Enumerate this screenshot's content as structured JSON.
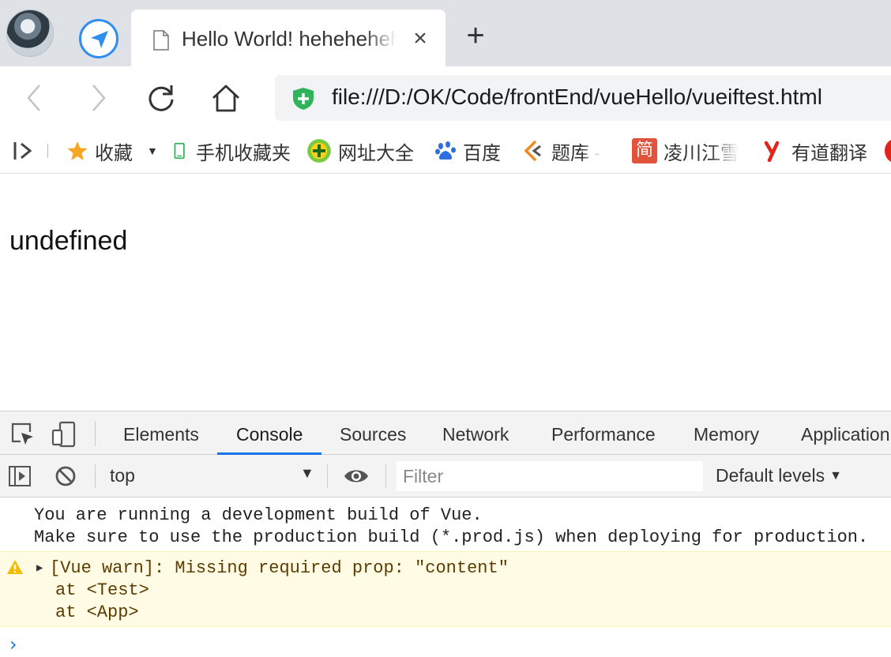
{
  "tabstrip": {
    "tab_title": "Hello World! hehehehehe",
    "new_tab_label": "+",
    "close_label": "×"
  },
  "toolbar": {
    "url": "file:///D:/OK/Code/frontEnd/vueHello/vueiftest.html"
  },
  "bookmarks": [
    {
      "label": "收藏",
      "icon": "star-icon"
    },
    {
      "label": "手机收藏夹",
      "icon": "phone-icon"
    },
    {
      "label": "网址大全",
      "icon": "plus-circle-icon"
    },
    {
      "label": "百度",
      "icon": "paw-icon"
    },
    {
      "label": "题库 -",
      "icon": "ticket-logo-icon"
    },
    {
      "label": "凌川江雪",
      "icon": "jian-logo-icon"
    },
    {
      "label": "有道翻译",
      "icon": "youdao-logo-icon"
    }
  ],
  "page": {
    "text": "undefined"
  },
  "devtools": {
    "tabs": [
      "Elements",
      "Console",
      "Sources",
      "Network",
      "Performance",
      "Memory",
      "Application"
    ],
    "active_tab": "Console",
    "context": "top",
    "filter_placeholder": "Filter",
    "levels_label": "Default levels",
    "log": [
      "You are running a development build of Vue.",
      "Make sure to use the production build (*.prod.js) when deploying for production."
    ],
    "warning": {
      "message": "[Vue warn]: Missing required prop: \"content\"",
      "trace": [
        "at <Test>",
        "at <App>"
      ]
    },
    "prompt": "›"
  },
  "colors": {
    "accent": "#1a73e8",
    "warning_bg": "#fffbe5",
    "warning_text": "#5c3c00",
    "tabstrip_bg": "#dee1e6",
    "shield_green": "#2fb35b"
  }
}
